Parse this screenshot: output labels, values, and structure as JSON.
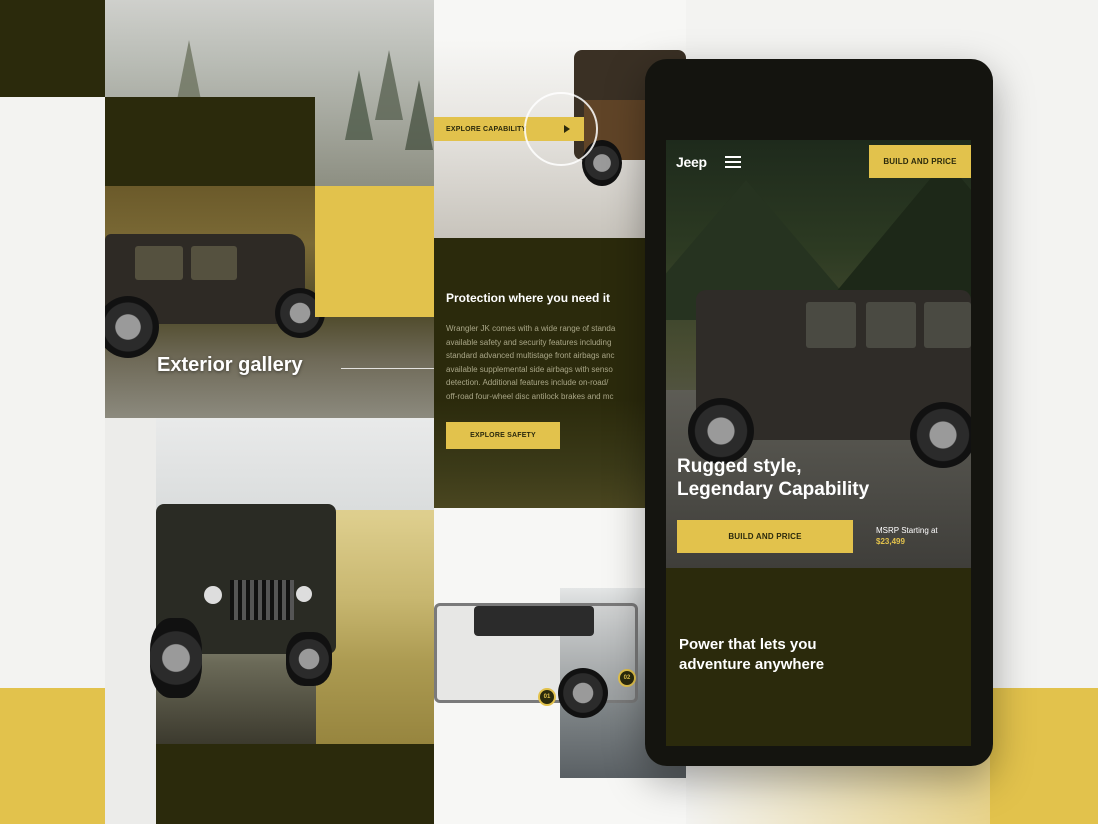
{
  "panel_left": {
    "gallery_heading": "Exterior gallery"
  },
  "panel_middle": {
    "explore_capability_label": "EXPLORE CAPABILITY",
    "protection_heading": "Protection where you need it",
    "protection_body": [
      "Wrangler JK comes with a wide range of standa",
      "available safety and security features including",
      "standard advanced multistage front airbags anc",
      "available supplemental side airbags with senso",
      "detection. Additional features include on-road/",
      "off-road four-wheel disc antilock brakes and mc"
    ],
    "explore_safety_label": "EXPLORE SAFETY",
    "hotspot_1": "01",
    "hotspot_2": "02"
  },
  "phone": {
    "brand": "Jeep",
    "header_cta": "BUILD AND PRICE",
    "hero_heading_line1": "Rugged style,",
    "hero_heading_line2": "Legendary Capability",
    "hero_cta": "BUILD AND PRICE",
    "msrp_label": "MSRP Starting at",
    "msrp_value": "$23,499",
    "power_heading_line1": "Power that lets you",
    "power_heading_line2": "adventure anywhere"
  },
  "colors": {
    "accent": "#e2c24c",
    "olive": "#2b2a0c",
    "phone_frame": "#14140f"
  },
  "icons": {
    "menu": "hamburger-icon",
    "play": "play-icon"
  }
}
